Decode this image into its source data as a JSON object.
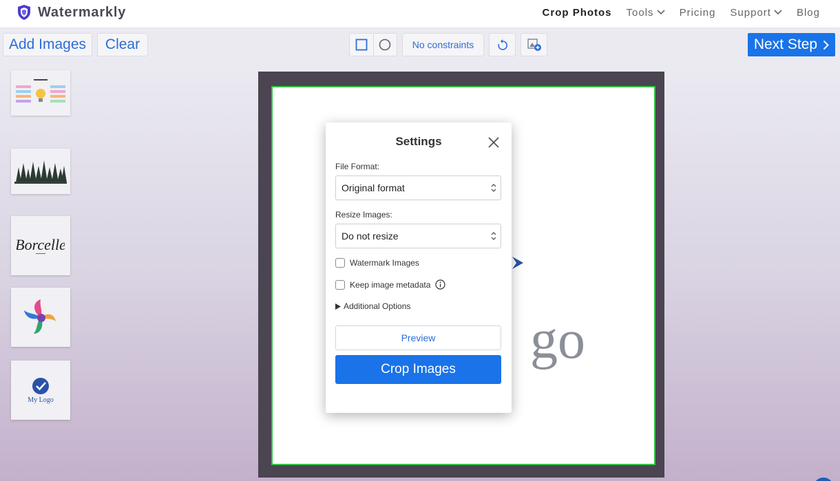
{
  "brand": {
    "name": "Watermarkly",
    "accent": "#4b3ccf"
  },
  "nav": [
    {
      "label": "Crop Photos",
      "active": true,
      "dropdown": false
    },
    {
      "label": "Tools",
      "active": false,
      "dropdown": true
    },
    {
      "label": "Pricing",
      "active": false,
      "dropdown": false
    },
    {
      "label": "Support",
      "active": false,
      "dropdown": true
    },
    {
      "label": "Blog",
      "active": false,
      "dropdown": false
    }
  ],
  "toolbar": {
    "add_images": "Add Images",
    "clear": "Clear",
    "constraints": "No constraints",
    "next_step": "Next Step",
    "shape_icons": [
      "square-crop-icon",
      "circle-crop-icon"
    ],
    "rotate_icon": "rotate-icon",
    "apply_all_icon": "apply-to-all-icon"
  },
  "thumbnails": [
    {
      "name": "thumb-infographic"
    },
    {
      "name": "thumb-forest"
    },
    {
      "name": "thumb-borcelle"
    },
    {
      "name": "thumb-colorful-logo"
    },
    {
      "name": "thumb-my-logo"
    }
  ],
  "canvas": {
    "visible_text": "go"
  },
  "settings": {
    "title": "Settings",
    "file_format_label": "File Format:",
    "file_format_value": "Original format",
    "resize_label": "Resize Images:",
    "resize_value": "Do not resize",
    "watermark_label": "Watermark Images",
    "watermark_checked": false,
    "metadata_label": "Keep image metadata",
    "metadata_checked": false,
    "additional_options": "Additional Options",
    "preview": "Preview",
    "crop": "Crop Images"
  },
  "colors": {
    "primary": "#1a73e8",
    "crop_border": "#35c248",
    "link": "#2d6dd6"
  }
}
